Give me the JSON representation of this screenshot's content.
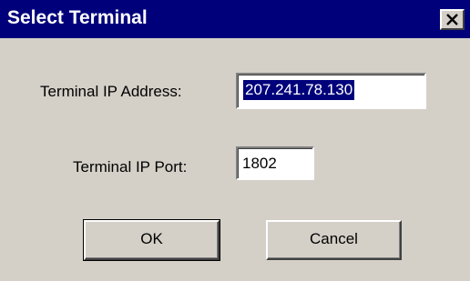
{
  "window": {
    "title": "Select Terminal",
    "close_icon": "close-icon"
  },
  "form": {
    "ip_label": "Terminal IP Address:",
    "ip_value": "207.241.78.130",
    "port_label": "Terminal IP Port:",
    "port_value": "1802"
  },
  "buttons": {
    "ok_label": "OK",
    "cancel_label": "Cancel"
  },
  "colors": {
    "titlebar": "#00007b",
    "dialog_face": "#d4d0c8",
    "selection": "#00007b"
  }
}
